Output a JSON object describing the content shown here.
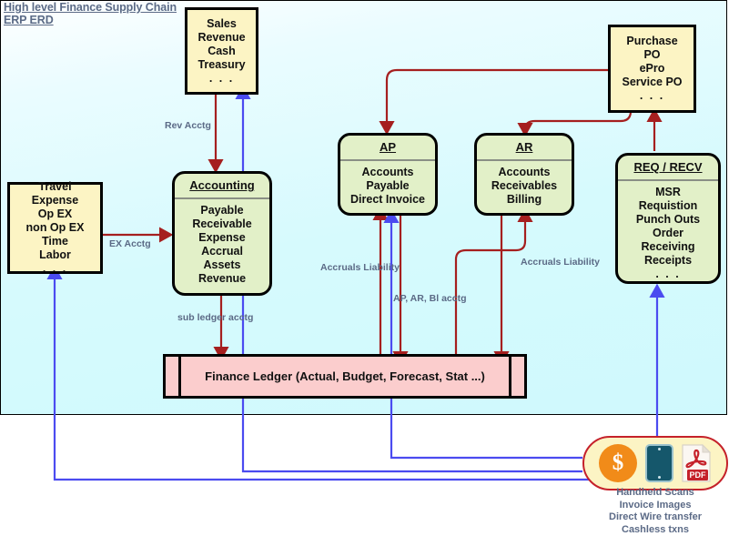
{
  "title": {
    "line1": "High level Finance Supply Chain",
    "line2": "ERP ERD"
  },
  "boxes": {
    "sales": {
      "name": "Sales",
      "lines": [
        "Sales",
        "Revenue",
        "Cash",
        "Treasury",
        ". . ."
      ]
    },
    "purchase": {
      "name": "Purchase",
      "lines": [
        "Purchase",
        "PO",
        "ePro",
        "Service PO",
        ". . ."
      ]
    },
    "travel": {
      "name": "Travel Expense",
      "lines": [
        "Travel",
        "Expense",
        "Op EX",
        "non Op EX",
        "Time",
        "Labor",
        ". . ."
      ]
    }
  },
  "modules": {
    "accounting": {
      "header": "Accounting",
      "lines": [
        "Payable",
        "Receivable",
        "Expense",
        "Accrual",
        "Assets",
        "Revenue",
        ". . ."
      ]
    },
    "ap": {
      "header": "AP",
      "lines": [
        "Accounts",
        "Payable",
        "Direct Invoice",
        ". . ."
      ]
    },
    "ar": {
      "header": "AR",
      "lines": [
        "Accounts",
        "Receivables",
        "Billing",
        ". . ."
      ]
    },
    "reqrecv": {
      "header": "REQ / RECV",
      "lines": [
        "MSR",
        "Requistion",
        "Punch Outs",
        "Order",
        "Receiving",
        "Receipts",
        ". . ."
      ]
    }
  },
  "ledger": {
    "label": "Finance Ledger (Actual, Budget, Forecast, Stat ...)"
  },
  "edge_labels": {
    "rev_acctg": "Rev Acctg",
    "ex_acctg": "EX Acctg",
    "sub_ledger_acctg": "sub ledger acctg",
    "accruals_liability_left": "Accruals\nLiability",
    "accruals_liability_left_l1": "Accruals",
    "accruals_liability_left_l2": "Liability",
    "ap_ar_bl_acctg": "AP, AR, Bl acctg",
    "accruals_liability_right_l1": "Accruals",
    "accruals_liability_right_l2": "Liability"
  },
  "devices": {
    "coin_symbol": "$",
    "pdf_label": "PDF",
    "caption": [
      "Handheld Scans",
      "Invoice Images",
      "Direct Wire transfer",
      "Cashless txns"
    ]
  },
  "colors": {
    "canvas": "#d6fafd",
    "entity_fill": "#fcf4c4",
    "module_fill": "#e2f0c8",
    "ledger_fill": "#fbcdcd",
    "red_flow": "#a51f1f",
    "blue_flow": "#4b4bf0",
    "label_text": "#5b6a86",
    "coin_orange": "#f18b19",
    "tablet_teal": "#15576b",
    "pdf_red": "#c5212a"
  }
}
